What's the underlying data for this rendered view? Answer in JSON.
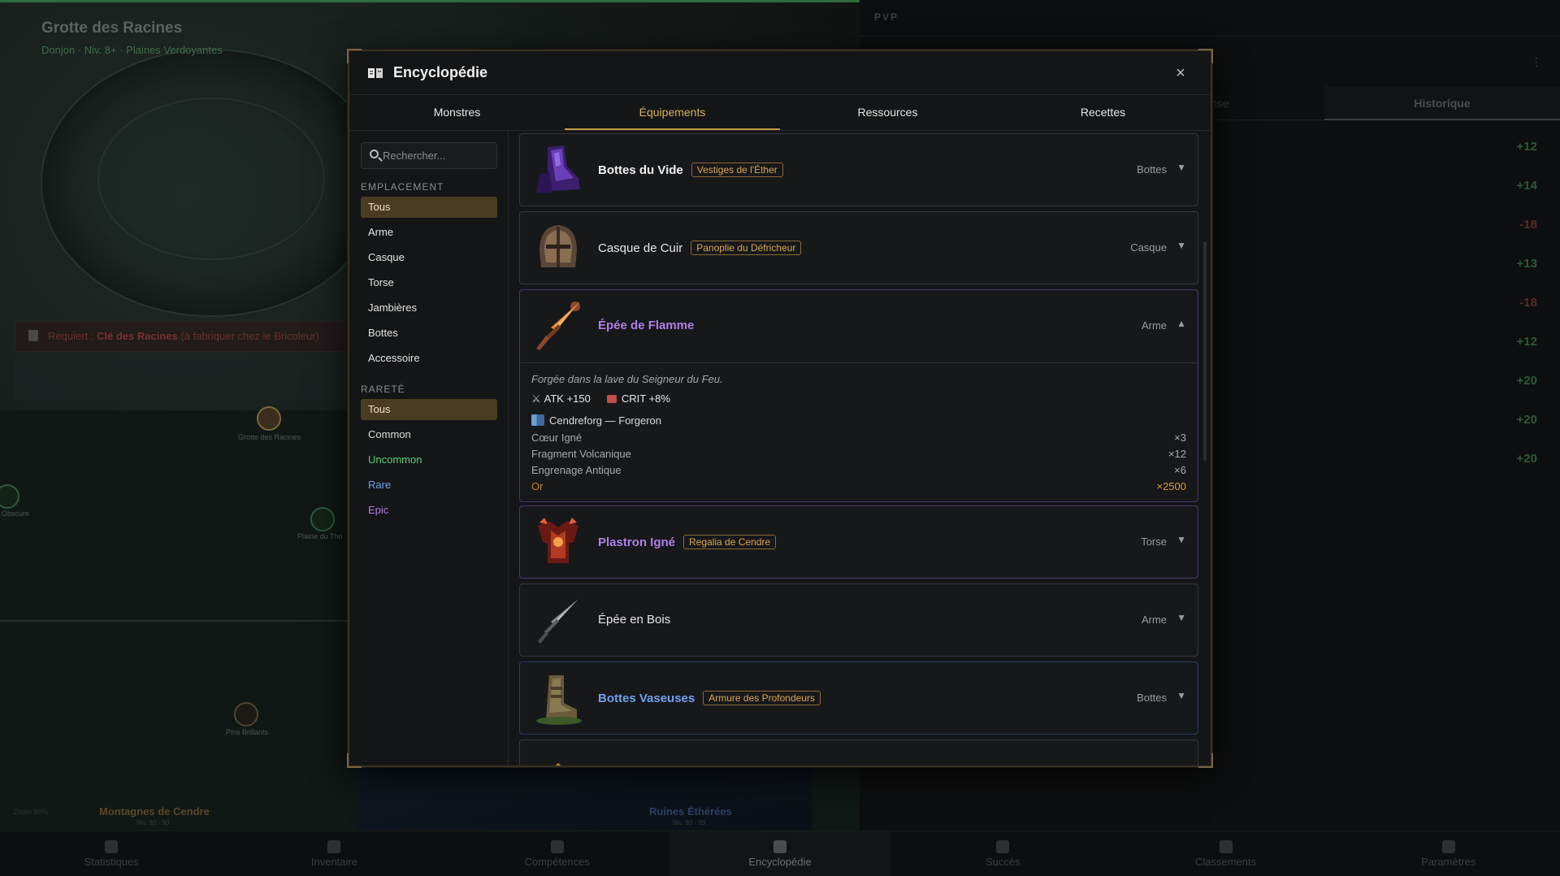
{
  "background": {
    "location_title": "Grotte des Racines",
    "location_sub": "Donjon · Niv. 8+ · Plaines Verdoyantes",
    "requirement": {
      "prefix": "Requiert : ",
      "key": "Clé des Racines",
      "suffix": " (à fabriquer chez le Bricoleur)"
    },
    "map_labels": [
      "Grotte des Racines",
      "Obscure",
      "Plaine du Tho",
      "Pins Brillants"
    ],
    "zones": [
      {
        "name": "Montagnes de Cendre",
        "sub": "Niv. 80 - 90"
      },
      {
        "name": "Ruines Éthérées",
        "sub": "Niv. 90 - 99"
      }
    ],
    "zoom": "Zoom 80%",
    "pvp_label": "PVP",
    "pvp_tab_partial": "nse",
    "pvp_tab_history": "Historique",
    "pvp_values": [
      {
        "v": "+12",
        "sign": "pos"
      },
      {
        "v": "+14",
        "sign": "pos"
      },
      {
        "v": "-18",
        "sign": "neg"
      },
      {
        "v": "+13",
        "sign": "pos"
      },
      {
        "v": "-18",
        "sign": "neg"
      },
      {
        "v": "+12",
        "sign": "pos"
      },
      {
        "v": "+20",
        "sign": "pos"
      },
      {
        "v": "+20",
        "sign": "pos"
      },
      {
        "v": "+20",
        "sign": "pos"
      }
    ]
  },
  "bottom_nav": [
    "Statistiques",
    "Inventaire",
    "Compétences",
    "Encyclopédie",
    "Succès",
    "Classements",
    "Paramètres"
  ],
  "modal": {
    "title": "Encyclopédie",
    "close": "×",
    "tabs": [
      "Monstres",
      "Équipements",
      "Ressources",
      "Recettes"
    ],
    "active_tab": 1,
    "search_placeholder": "Rechercher...",
    "emplacement_heading": "EMPLACEMENT",
    "emplacement": [
      "Tous",
      "Arme",
      "Casque",
      "Torse",
      "Jambières",
      "Bottes",
      "Accessoire"
    ],
    "rarete_heading": "RARETÉ",
    "rarete": [
      "Tous",
      "Common",
      "Uncommon",
      "Rare",
      "Epic"
    ]
  },
  "items": [
    {
      "name": "Bottes du Vide",
      "set": "Vestiges de l'Éther",
      "type": "Bottes",
      "chevron": "▼"
    },
    {
      "name": "Casque de Cuir",
      "set": "Panoplie du Défricheur",
      "type": "Casque",
      "chevron": "▼"
    },
    {
      "name": "Épée de Flamme",
      "type": "Arme",
      "chevron": "▲",
      "description": "Forgée dans la lave du Seigneur du Feu.",
      "stats": [
        {
          "sym": "⚔",
          "text": "ATK +150"
        },
        {
          "text": "CRIT +8%"
        }
      ],
      "crafting": "Cendreforg — Forgeron",
      "materials": [
        {
          "name": "Cœur Igné",
          "qty": "×3"
        },
        {
          "name": "Fragment Volcanique",
          "qty": "×12"
        },
        {
          "name": "Engrenage Antique",
          "qty": "×6"
        },
        {
          "name": "Or",
          "qty": "×2500"
        }
      ]
    },
    {
      "name": "Plastron Igné",
      "set": "Regalia de Cendre",
      "type": "Torse",
      "chevron": "▼"
    },
    {
      "name": "Épée en Bois",
      "type": "Arme",
      "chevron": "▼"
    },
    {
      "name": "Bottes Vaseuses",
      "set": "Armure des Profondeurs",
      "type": "Bottes",
      "chevron": "▼"
    }
  ]
}
